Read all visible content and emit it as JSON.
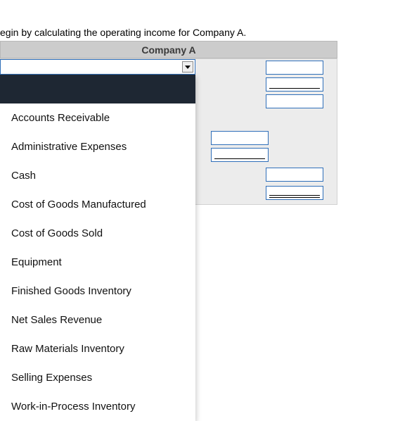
{
  "instruction": "egin by calculating the operating income for Company A.",
  "header": "Company A",
  "dropdown": {
    "options": [
      "",
      "Accounts Receivable",
      "Administrative Expenses",
      "Cash",
      "Cost of Goods Manufactured",
      "Cost of Goods Sold",
      "Equipment",
      "Finished Goods Inventory",
      "Net Sales Revenue",
      "Raw Materials Inventory",
      "Selling Expenses",
      "Work-in-Process Inventory"
    ]
  },
  "inputs": {
    "r1": "",
    "r2": "",
    "r3": "",
    "m4": "",
    "m5": "",
    "r6": "",
    "r7": ""
  }
}
